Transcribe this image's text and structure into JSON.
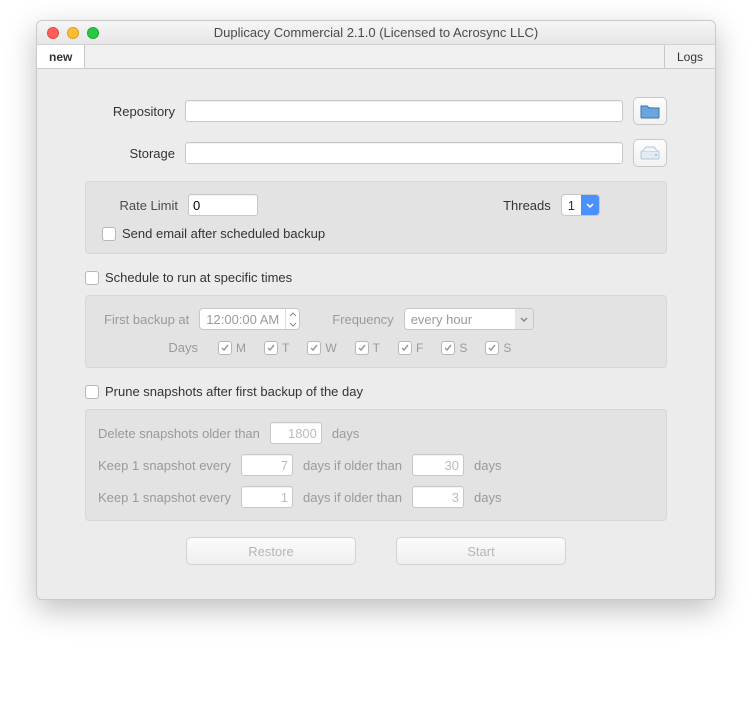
{
  "window": {
    "title": "Duplicacy Commercial 2.1.0 (Licensed to Acrosync LLC)"
  },
  "tabs": {
    "active": "new",
    "logs": "Logs"
  },
  "form": {
    "repository_label": "Repository",
    "repository_value": "",
    "storage_label": "Storage",
    "storage_value": ""
  },
  "options": {
    "rate_limit_label": "Rate Limit",
    "rate_limit_value": "0",
    "threads_label": "Threads",
    "threads_value": "1",
    "send_email_label": "Send email after scheduled backup",
    "send_email_checked": false
  },
  "schedule": {
    "enable_label": "Schedule to run at specific times",
    "enable_checked": false,
    "first_backup_label": "First backup at",
    "first_backup_value": "12:00:00 AM",
    "frequency_label": "Frequency",
    "frequency_value": "every hour",
    "days_label": "Days",
    "days": [
      "M",
      "T",
      "W",
      "T",
      "F",
      "S",
      "S"
    ]
  },
  "prune": {
    "enable_label": "Prune snapshots after first backup of the day",
    "enable_checked": false,
    "delete_label_pre": "Delete snapshots older than",
    "delete_value": "1800",
    "delete_label_post": "days",
    "keep1_pre": "Keep 1 snapshot every",
    "keep1_val1": "7",
    "keep1_mid": "days if older than",
    "keep1_val2": "30",
    "keep1_post": "days",
    "keep2_pre": "Keep 1 snapshot every",
    "keep2_val1": "1",
    "keep2_mid": "days if older than",
    "keep2_val2": "3",
    "keep2_post": "days"
  },
  "buttons": {
    "restore": "Restore",
    "start": "Start"
  }
}
